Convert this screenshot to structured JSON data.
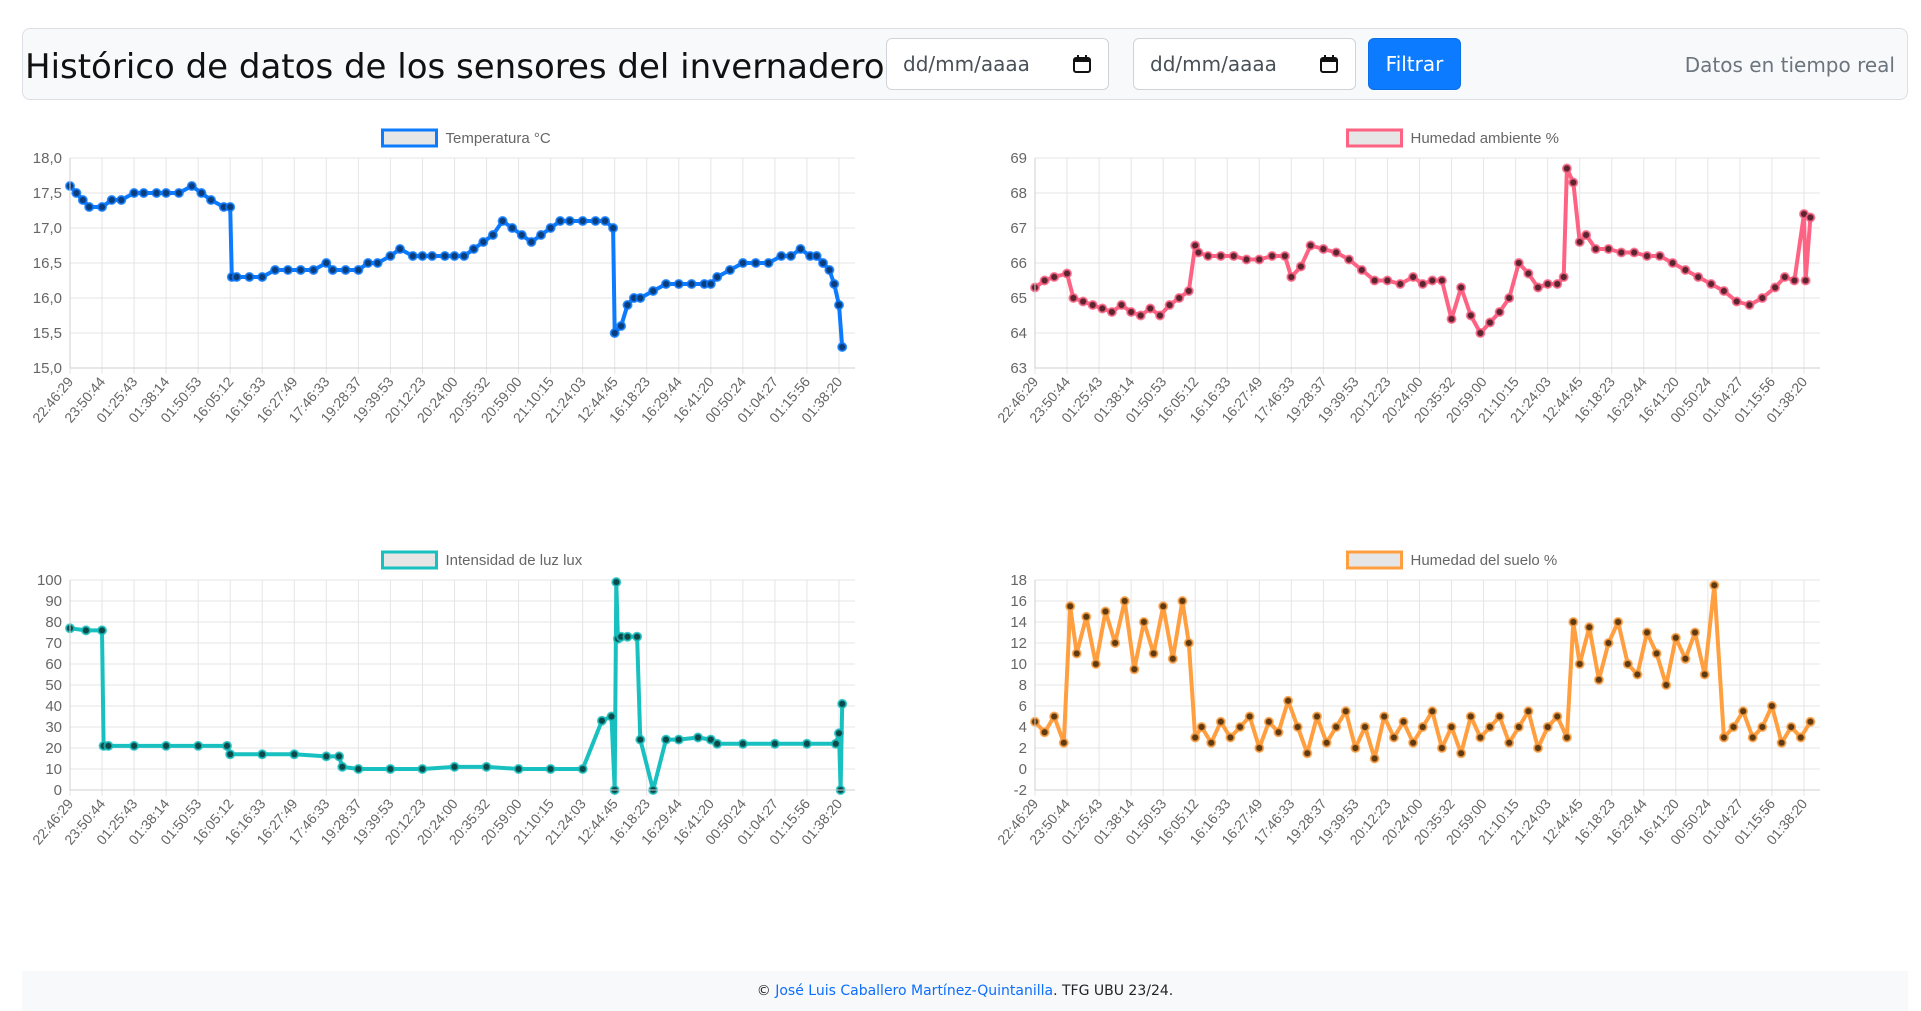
{
  "header": {
    "title": "Histórico de datos de los sensores del invernadero.",
    "date_from": {
      "placeholder": "dd/mm/aaaa"
    },
    "date_to": {
      "placeholder": "dd/mm/aaaa"
    },
    "filter_label": "Filtrar",
    "realtime_label": "Datos en tiempo real",
    "accent_color": "#0d7bff"
  },
  "footer": {
    "copyright_symbol": "©",
    "author": "José Luis Caballero Martínez-Quintanilla",
    "suffix": ". TFG UBU 23/24."
  },
  "chart_data": [
    {
      "id": "temperature",
      "type": "line",
      "title": "",
      "xlabel": "",
      "ylabel": "",
      "legend_position": "top",
      "grid": true,
      "color": "#0d7bff",
      "point_color": "#0a3d7a",
      "ylim": [
        15.0,
        18.0
      ],
      "y_ticks": [
        "18,0",
        "17,5",
        "17,0",
        "16,5",
        "16,0",
        "15,5",
        "15,0"
      ],
      "x_ticks": [
        "22:46:29",
        "23:50:44",
        "01:25:43",
        "01:38:14",
        "01:50:53",
        "16:05:12",
        "16:16:33",
        "16:27:49",
        "17:46:33",
        "19:28:37",
        "19:39:53",
        "20:12:23",
        "20:24:00",
        "20:35:32",
        "20:59:00",
        "21:10:15",
        "21:24:03",
        "12:44:45",
        "16:18:23",
        "16:29:44",
        "16:41:20",
        "00:50:24",
        "01:04:27",
        "01:15:56",
        "01:38:20"
      ],
      "series": [
        {
          "name": "Temperatura °C",
          "x": [
            0.0,
            0.2,
            0.4,
            0.6,
            1.0,
            1.3,
            1.6,
            2.0,
            2.3,
            2.7,
            3.0,
            3.4,
            3.8,
            4.1,
            4.4,
            4.8,
            5.0,
            5.05,
            5.2,
            5.6,
            6.0,
            6.4,
            6.8,
            7.2,
            7.6,
            8.0,
            8.2,
            8.6,
            9.0,
            9.3,
            9.6,
            10.0,
            10.3,
            10.7,
            11.0,
            11.3,
            11.7,
            12.0,
            12.3,
            12.6,
            12.9,
            13.2,
            13.5,
            13.8,
            14.1,
            14.4,
            14.7,
            15.0,
            15.3,
            15.6,
            16.0,
            16.4,
            16.7,
            16.95,
            17.0,
            17.2,
            17.4,
            17.6,
            17.8,
            18.2,
            18.6,
            19.0,
            19.4,
            19.8,
            20.0,
            20.2,
            20.6,
            21.0,
            21.4,
            21.8,
            22.2,
            22.5,
            22.8,
            23.1,
            23.3,
            23.5,
            23.7,
            23.85,
            24.0,
            24.1
          ],
          "values": [
            17.6,
            17.5,
            17.4,
            17.3,
            17.3,
            17.4,
            17.4,
            17.5,
            17.5,
            17.5,
            17.5,
            17.5,
            17.6,
            17.5,
            17.4,
            17.3,
            17.3,
            16.3,
            16.3,
            16.3,
            16.3,
            16.4,
            16.4,
            16.4,
            16.4,
            16.5,
            16.4,
            16.4,
            16.4,
            16.5,
            16.5,
            16.6,
            16.7,
            16.6,
            16.6,
            16.6,
            16.6,
            16.6,
            16.6,
            16.7,
            16.8,
            16.9,
            17.1,
            17.0,
            16.9,
            16.8,
            16.9,
            17.0,
            17.1,
            17.1,
            17.1,
            17.1,
            17.1,
            17.0,
            15.5,
            15.6,
            15.9,
            16.0,
            16.0,
            16.1,
            16.2,
            16.2,
            16.2,
            16.2,
            16.2,
            16.3,
            16.4,
            16.5,
            16.5,
            16.5,
            16.6,
            16.6,
            16.7,
            16.6,
            16.6,
            16.5,
            16.4,
            16.2,
            15.9,
            15.3
          ]
        }
      ]
    },
    {
      "id": "humidity",
      "type": "line",
      "title": "",
      "xlabel": "",
      "ylabel": "",
      "legend_position": "top",
      "grid": true,
      "color": "#ff6384",
      "point_color": "#5a2431",
      "ylim": [
        63,
        69
      ],
      "y_ticks": [
        "69",
        "68",
        "67",
        "66",
        "65",
        "64",
        "63"
      ],
      "x_ticks": [
        "22:46:29",
        "23:50:44",
        "01:25:43",
        "01:38:14",
        "01:50:53",
        "16:05:12",
        "16:16:33",
        "16:27:49",
        "17:46:33",
        "19:28:37",
        "19:39:53",
        "20:12:23",
        "20:24:00",
        "20:35:32",
        "20:59:00",
        "21:10:15",
        "21:24:03",
        "12:44:45",
        "16:18:23",
        "16:29:44",
        "16:41:20",
        "00:50:24",
        "01:04:27",
        "01:15:56",
        "01:38:20"
      ],
      "series": [
        {
          "name": "Humedad ambiente %",
          "x": [
            0.0,
            0.3,
            0.6,
            1.0,
            1.2,
            1.5,
            1.8,
            2.1,
            2.4,
            2.7,
            3.0,
            3.3,
            3.6,
            3.9,
            4.2,
            4.5,
            4.8,
            5.0,
            5.1,
            5.4,
            5.8,
            6.2,
            6.6,
            7.0,
            7.4,
            7.8,
            8.0,
            8.3,
            8.6,
            9.0,
            9.4,
            9.8,
            10.2,
            10.6,
            11.0,
            11.4,
            11.8,
            12.1,
            12.4,
            12.7,
            13.0,
            13.3,
            13.6,
            13.9,
            14.2,
            14.5,
            14.8,
            15.1,
            15.4,
            15.7,
            16.0,
            16.3,
            16.5,
            16.6,
            16.8,
            17.0,
            17.2,
            17.5,
            17.9,
            18.3,
            18.7,
            19.1,
            19.5,
            19.9,
            20.3,
            20.7,
            21.1,
            21.5,
            21.9,
            22.3,
            22.7,
            23.1,
            23.4,
            23.7,
            24.0,
            24.05,
            24.2
          ],
          "values": [
            65.3,
            65.5,
            65.6,
            65.7,
            65.0,
            64.9,
            64.8,
            64.7,
            64.6,
            64.8,
            64.6,
            64.5,
            64.7,
            64.5,
            64.8,
            65.0,
            65.2,
            66.5,
            66.3,
            66.2,
            66.2,
            66.2,
            66.1,
            66.1,
            66.2,
            66.2,
            65.6,
            65.9,
            66.5,
            66.4,
            66.3,
            66.1,
            65.8,
            65.5,
            65.5,
            65.4,
            65.6,
            65.4,
            65.5,
            65.5,
            64.4,
            65.3,
            64.5,
            64.0,
            64.3,
            64.6,
            65.0,
            66.0,
            65.7,
            65.3,
            65.4,
            65.4,
            65.6,
            68.7,
            68.3,
            66.6,
            66.8,
            66.4,
            66.4,
            66.3,
            66.3,
            66.2,
            66.2,
            66.0,
            65.8,
            65.6,
            65.4,
            65.2,
            64.9,
            64.8,
            65.0,
            65.3,
            65.6,
            65.5,
            67.4,
            65.5,
            67.3
          ]
        }
      ]
    },
    {
      "id": "light",
      "type": "line",
      "title": "",
      "xlabel": "",
      "ylabel": "",
      "legend_position": "top",
      "grid": true,
      "color": "#19c0c0",
      "point_color": "#0c4a4a",
      "ylim": [
        0,
        100
      ],
      "y_ticks": [
        "100",
        "90",
        "80",
        "70",
        "60",
        "50",
        "40",
        "30",
        "20",
        "10",
        "0"
      ],
      "x_ticks": [
        "22:46:29",
        "23:50:44",
        "01:25:43",
        "01:38:14",
        "01:50:53",
        "16:05:12",
        "16:16:33",
        "16:27:49",
        "17:46:33",
        "19:28:37",
        "19:39:53",
        "20:12:23",
        "20:24:00",
        "20:35:32",
        "20:59:00",
        "21:10:15",
        "21:24:03",
        "12:44:45",
        "16:18:23",
        "16:29:44",
        "16:41:20",
        "00:50:24",
        "01:04:27",
        "01:15:56",
        "01:38:20"
      ],
      "series": [
        {
          "name": "Intensidad de luz lux",
          "x": [
            0.0,
            0.5,
            1.0,
            1.05,
            1.2,
            2.0,
            3.0,
            4.0,
            4.9,
            5.0,
            6.0,
            7.0,
            8.0,
            8.4,
            8.5,
            9.0,
            10.0,
            11.0,
            12.0,
            13.0,
            14.0,
            15.0,
            16.0,
            16.6,
            16.9,
            17.0,
            17.05,
            17.1,
            17.2,
            17.4,
            17.7,
            17.8,
            18.2,
            18.6,
            19.0,
            19.6,
            20.0,
            20.2,
            21.0,
            22.0,
            23.0,
            23.9,
            24.0,
            24.05,
            24.1
          ],
          "values": [
            77,
            76,
            76,
            21,
            21,
            21,
            21,
            21,
            21,
            17,
            17,
            17,
            16,
            16,
            11,
            10,
            10,
            10,
            11,
            11,
            10,
            10,
            10,
            33,
            35,
            0,
            99,
            72,
            73,
            73,
            73,
            24,
            0,
            24,
            24,
            25,
            24,
            22,
            22,
            22,
            22,
            22,
            27,
            0,
            41
          ]
        }
      ]
    },
    {
      "id": "soil",
      "type": "line",
      "title": "",
      "xlabel": "",
      "ylabel": "",
      "legend_position": "top",
      "grid": true,
      "color": "#ff9f40",
      "point_color": "#5e3a12",
      "ylim": [
        -2,
        18
      ],
      "y_ticks": [
        "18",
        "16",
        "14",
        "12",
        "10",
        "8",
        "6",
        "4",
        "2",
        "0",
        "-2"
      ],
      "x_ticks": [
        "22:46:29",
        "23:50:44",
        "01:25:43",
        "01:38:14",
        "01:50:53",
        "16:05:12",
        "16:16:33",
        "16:27:49",
        "17:46:33",
        "19:28:37",
        "19:39:53",
        "20:12:23",
        "20:24:00",
        "20:35:32",
        "20:59:00",
        "21:10:15",
        "21:24:03",
        "12:44:45",
        "16:18:23",
        "16:29:44",
        "16:41:20",
        "00:50:24",
        "01:04:27",
        "01:15:56",
        "01:38:20"
      ],
      "series": [
        {
          "name": "Humedad del suelo %",
          "x": [
            0.0,
            0.3,
            0.6,
            0.9,
            1.1,
            1.3,
            1.6,
            1.9,
            2.2,
            2.5,
            2.8,
            3.1,
            3.4,
            3.7,
            4.0,
            4.3,
            4.6,
            4.8,
            5.0,
            5.2,
            5.5,
            5.8,
            6.1,
            6.4,
            6.7,
            7.0,
            7.3,
            7.6,
            7.9,
            8.2,
            8.5,
            8.8,
            9.1,
            9.4,
            9.7,
            10.0,
            10.3,
            10.6,
            10.9,
            11.2,
            11.5,
            11.8,
            12.1,
            12.4,
            12.7,
            13.0,
            13.3,
            13.6,
            13.9,
            14.2,
            14.5,
            14.8,
            15.1,
            15.4,
            15.7,
            16.0,
            16.3,
            16.6,
            16.8,
            17.0,
            17.3,
            17.6,
            17.9,
            18.2,
            18.5,
            18.8,
            19.1,
            19.4,
            19.7,
            20.0,
            20.3,
            20.6,
            20.9,
            21.2,
            21.5,
            21.8,
            22.1,
            22.4,
            22.7,
            23.0,
            23.3,
            23.6,
            23.9,
            24.2
          ],
          "values": [
            4.5,
            3.5,
            5.0,
            2.5,
            15.5,
            11.0,
            14.5,
            10.0,
            15.0,
            12.0,
            16.0,
            9.5,
            14.0,
            11.0,
            15.5,
            10.5,
            16.0,
            12.0,
            3.0,
            4.0,
            2.5,
            4.5,
            3.0,
            4.0,
            5.0,
            2.0,
            4.5,
            3.5,
            6.5,
            4.0,
            1.5,
            5.0,
            2.5,
            4.0,
            5.5,
            2.0,
            4.0,
            1.0,
            5.0,
            3.0,
            4.5,
            2.5,
            4.0,
            5.5,
            2.0,
            4.0,
            1.5,
            5.0,
            3.0,
            4.0,
            5.0,
            2.5,
            4.0,
            5.5,
            2.0,
            4.0,
            5.0,
            3.0,
            14.0,
            10.0,
            13.5,
            8.5,
            12.0,
            14.0,
            10.0,
            9.0,
            13.0,
            11.0,
            8.0,
            12.5,
            10.5,
            13.0,
            9.0,
            17.5,
            3.0,
            4.0,
            5.5,
            3.0,
            4.0,
            6.0,
            2.5,
            4.0,
            3.0,
            4.5
          ]
        }
      ]
    }
  ]
}
